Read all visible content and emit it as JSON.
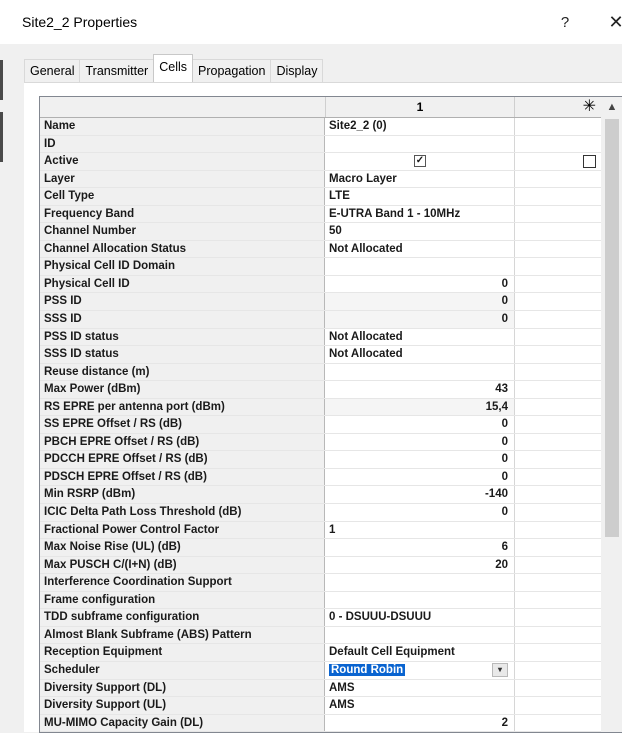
{
  "window": {
    "title": "Site2_2 Properties",
    "help": "?",
    "close": "✕"
  },
  "tabs": [
    "General",
    "Transmitter",
    "Cells",
    "Propagation",
    "Display"
  ],
  "grid": {
    "col1_header": "1",
    "new_col_header": "✳",
    "rows": [
      {
        "name": "Name",
        "value": "Site2_2 (0)",
        "align": "left"
      },
      {
        "name": "ID",
        "value": "",
        "align": "left"
      },
      {
        "name": "Active",
        "value": "",
        "align": "left",
        "checkbox": true
      },
      {
        "name": "Layer",
        "value": "Macro Layer",
        "align": "left"
      },
      {
        "name": "Cell Type",
        "value": "LTE",
        "align": "left"
      },
      {
        "name": "Frequency Band",
        "value": "E-UTRA Band 1 - 10MHz",
        "align": "left"
      },
      {
        "name": "Channel Number",
        "value": "50",
        "align": "left"
      },
      {
        "name": "Channel Allocation Status",
        "value": "Not Allocated",
        "align": "left"
      },
      {
        "name": "Physical Cell ID Domain",
        "value": "",
        "align": "left"
      },
      {
        "name": "Physical Cell ID",
        "value": "0",
        "align": "right"
      },
      {
        "name": "PSS ID",
        "value": "0",
        "align": "right",
        "shaded": true
      },
      {
        "name": "SSS ID",
        "value": "0",
        "align": "right",
        "shaded": true
      },
      {
        "name": "PSS ID status",
        "value": "Not Allocated",
        "align": "left"
      },
      {
        "name": "SSS ID status",
        "value": "Not Allocated",
        "align": "left"
      },
      {
        "name": "Reuse distance (m)",
        "value": "",
        "align": "left"
      },
      {
        "name": "Max Power (dBm)",
        "value": "43",
        "align": "right"
      },
      {
        "name": "RS EPRE per antenna port (dBm)",
        "value": "15,4",
        "align": "right",
        "shaded": true
      },
      {
        "name": "SS EPRE Offset / RS (dB)",
        "value": "0",
        "align": "right"
      },
      {
        "name": "PBCH EPRE Offset / RS (dB)",
        "value": "0",
        "align": "right"
      },
      {
        "name": "PDCCH EPRE Offset / RS (dB)",
        "value": "0",
        "align": "right"
      },
      {
        "name": "PDSCH EPRE Offset / RS (dB)",
        "value": "0",
        "align": "right"
      },
      {
        "name": "Min RSRP (dBm)",
        "value": "-140",
        "align": "right"
      },
      {
        "name": "ICIC Delta Path Loss Threshold (dB)",
        "value": "0",
        "align": "right"
      },
      {
        "name": "Fractional Power Control Factor",
        "value": "1",
        "align": "left"
      },
      {
        "name": "Max Noise Rise (UL) (dB)",
        "value": "6",
        "align": "right"
      },
      {
        "name": "Max PUSCH C/(I+N) (dB)",
        "value": "20",
        "align": "right"
      },
      {
        "name": "Interference Coordination Support",
        "value": "",
        "align": "left"
      },
      {
        "name": "Frame configuration",
        "value": "",
        "align": "left"
      },
      {
        "name": "TDD subframe configuration",
        "value": "0 - DSUUU-DSUUU",
        "align": "left"
      },
      {
        "name": "Almost Blank Subframe (ABS) Pattern",
        "value": "",
        "align": "left"
      },
      {
        "name": "Reception Equipment",
        "value": "Default Cell Equipment",
        "align": "left"
      },
      {
        "name": "Scheduler",
        "value": "Round Robin",
        "align": "left",
        "selected": true
      },
      {
        "name": "Diversity Support (DL)",
        "value": "AMS",
        "align": "left"
      },
      {
        "name": "Diversity Support (UL)",
        "value": "AMS",
        "align": "left"
      },
      {
        "name": "MU-MIMO Capacity Gain (DL)",
        "value": "2",
        "align": "right"
      }
    ]
  }
}
